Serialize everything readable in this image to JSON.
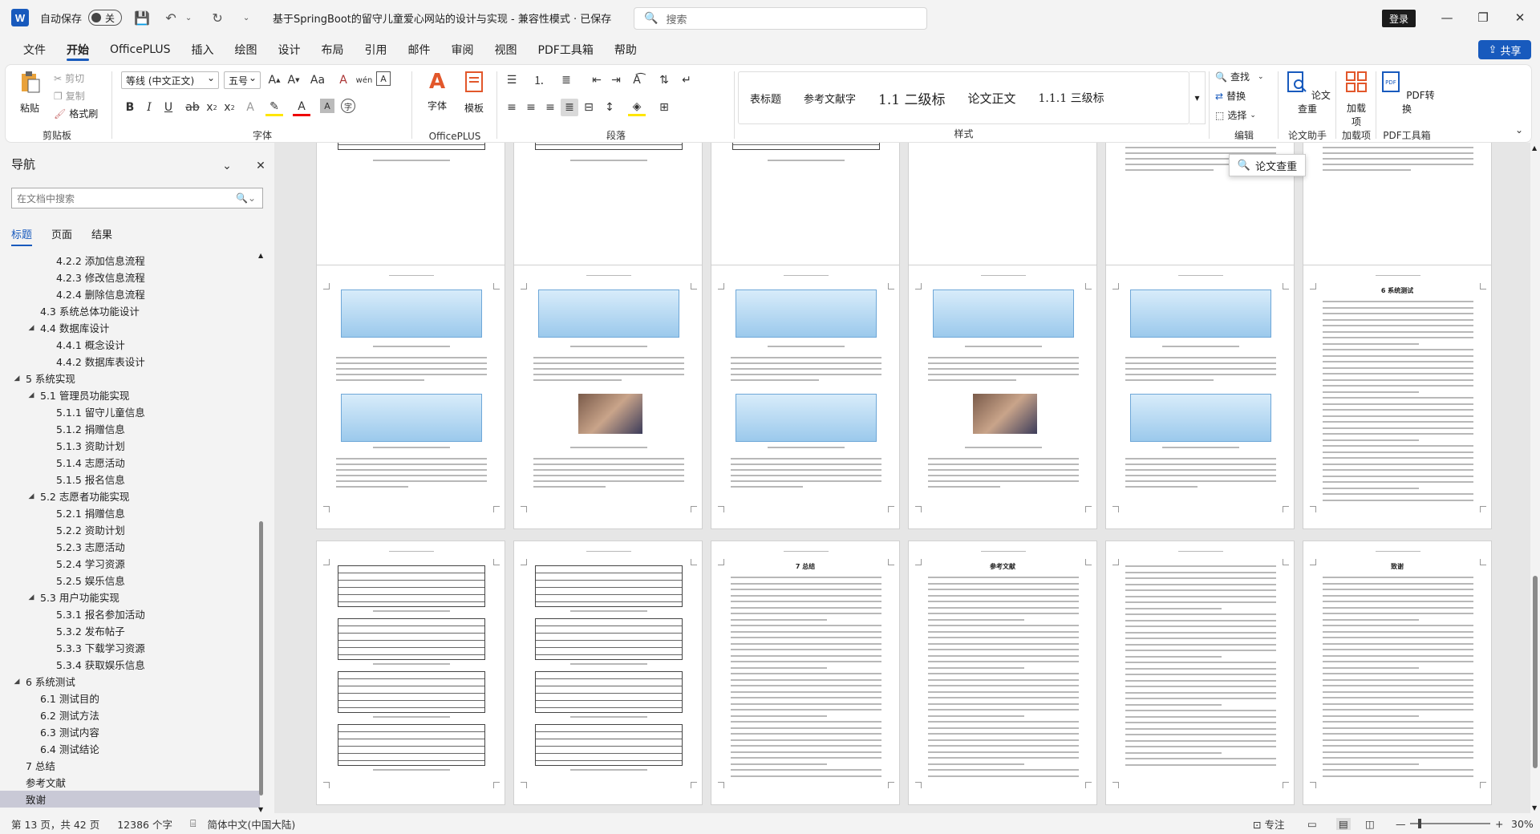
{
  "titlebar": {
    "app_icon": "W",
    "autosave_label": "自动保存",
    "autosave_state": "关",
    "doc_title": "基于SpringBoot的留守儿童爱心网站的设计与实现  -  兼容性模式 · 已保存",
    "search_placeholder": "搜索",
    "login_label": "登录"
  },
  "menu": {
    "items": [
      "文件",
      "开始",
      "OfficePLUS",
      "插入",
      "绘图",
      "设计",
      "布局",
      "引用",
      "邮件",
      "审阅",
      "视图",
      "PDF工具箱",
      "帮助"
    ],
    "active": "开始",
    "share": "共享"
  },
  "ribbon": {
    "clipboard": {
      "paste": "粘贴",
      "cut": "剪切",
      "copy": "复制",
      "format_painter": "格式刷",
      "label": "剪贴板"
    },
    "font": {
      "font_name": "等线 (中文正文)",
      "font_size": "五号",
      "label": "字体"
    },
    "officeplus": {
      "font_btn": "字体",
      "template_btn": "模板",
      "label": "OfficePLUS"
    },
    "paragraph": {
      "label": "段落"
    },
    "styles": {
      "items": [
        "表标题",
        "参考文献字",
        "1.1  二级标",
        "论文正文",
        "1.1.1  三级标"
      ],
      "label": "样式"
    },
    "editing": {
      "find": "查找",
      "replace": "替换",
      "select": "选择",
      "label": "编辑"
    },
    "assistant": {
      "btn": "论文查重",
      "label": "论文助手"
    },
    "addins": {
      "btn": "加载项",
      "label": "加载项"
    },
    "pdf": {
      "btn": "PDF转换",
      "label": "PDF工具箱"
    }
  },
  "nav": {
    "title": "导航",
    "search_placeholder": "在文档中搜索",
    "tabs": [
      "标题",
      "页面",
      "结果"
    ],
    "items": [
      {
        "text": "4.2.2 添加信息流程",
        "level": 3
      },
      {
        "text": "4.2.3 修改信息流程",
        "level": 3
      },
      {
        "text": "4.2.4 删除信息流程",
        "level": 3
      },
      {
        "text": "4.3 系统总体功能设计",
        "level": 2
      },
      {
        "text": "4.4 数据库设计",
        "level": 2,
        "expand": true
      },
      {
        "text": "4.4.1 概念设计",
        "level": 3
      },
      {
        "text": "4.4.2 数据库表设计",
        "level": 3
      },
      {
        "text": "5 系统实现",
        "level": 1,
        "expand": true
      },
      {
        "text": "5.1 管理员功能实现",
        "level": 2,
        "expand": true
      },
      {
        "text": "5.1.1 留守儿童信息",
        "level": 3
      },
      {
        "text": "5.1.2 捐赠信息",
        "level": 3
      },
      {
        "text": "5.1.3 资助计划",
        "level": 3
      },
      {
        "text": "5.1.4 志愿活动",
        "level": 3
      },
      {
        "text": "5.1.5 报名信息",
        "level": 3
      },
      {
        "text": "5.2 志愿者功能实现",
        "level": 2,
        "expand": true
      },
      {
        "text": "5.2.1 捐赠信息",
        "level": 3
      },
      {
        "text": "5.2.2 资助计划",
        "level": 3
      },
      {
        "text": "5.2.3 志愿活动",
        "level": 3
      },
      {
        "text": "5.2.4 学习资源",
        "level": 3
      },
      {
        "text": "5.2.5 娱乐信息",
        "level": 3
      },
      {
        "text": "5.3 用户功能实现",
        "level": 2,
        "expand": true
      },
      {
        "text": "5.3.1 报名参加活动",
        "level": 3
      },
      {
        "text": "5.3.2 发布帖子",
        "level": 3
      },
      {
        "text": "5.3.3 下载学习资源",
        "level": 3
      },
      {
        "text": "5.3.4 获取娱乐信息",
        "level": 3
      },
      {
        "text": "6 系统测试",
        "level": 1,
        "expand": true
      },
      {
        "text": "6.1 测试目的",
        "level": 2
      },
      {
        "text": "6.2 测试方法",
        "level": 2
      },
      {
        "text": "6.3 测试内容",
        "level": 2
      },
      {
        "text": "6.4 测试结论",
        "level": 2
      },
      {
        "text": "7 总结",
        "level": 1
      },
      {
        "text": "参考文献",
        "level": 1
      },
      {
        "text": "致谢",
        "level": 1,
        "current": true
      }
    ]
  },
  "pages": {
    "titles": {
      "p_conclusion": "7  总结",
      "p_refs": "参考文献",
      "p_thanks": "致谢",
      "p_test": "6  系统测试"
    }
  },
  "tooltip": "论文查重",
  "status": {
    "page": "第 13 页，共 42 页",
    "words": "12386 个字",
    "lang": "简体中文(中国大陆)",
    "focus": "专注",
    "zoom": "30%"
  }
}
